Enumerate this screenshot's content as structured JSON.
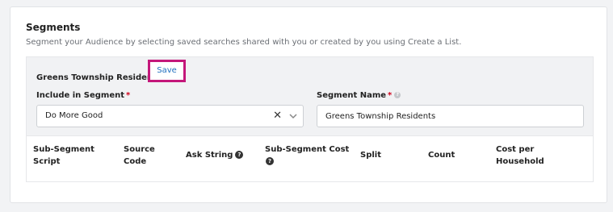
{
  "section": {
    "title": "Segments",
    "subtitle": "Segment your Audience by selecting saved searches shared with you or created by you using Create a List."
  },
  "segment": {
    "name": "Greens Township Residents",
    "save_label": "Save"
  },
  "fields": {
    "include_label": "Include in Segment",
    "include_value": "Do More Good",
    "name_label": "Segment Name",
    "name_value": "Greens Township Residents",
    "required_mark": "*"
  },
  "table": {
    "columns": [
      {
        "line1": "Sub-Segment",
        "line2": "Script"
      },
      {
        "line1": "Source",
        "line2": "Code"
      },
      {
        "line1": "Ask String",
        "line2": ""
      },
      {
        "line1": "Sub-Segment Cost",
        "line2": ""
      },
      {
        "line1": "Split",
        "line2": ""
      },
      {
        "line1": "Count",
        "line2": ""
      },
      {
        "line1": "Cost per",
        "line2": "Household"
      }
    ]
  },
  "colors": {
    "accent_link": "#1f6fbf",
    "highlight_border": "#c4177a",
    "required": "#d0021b"
  },
  "icons": {
    "clear": "close-icon",
    "dropdown": "chevron-down-icon",
    "help": "question-circle-icon"
  }
}
